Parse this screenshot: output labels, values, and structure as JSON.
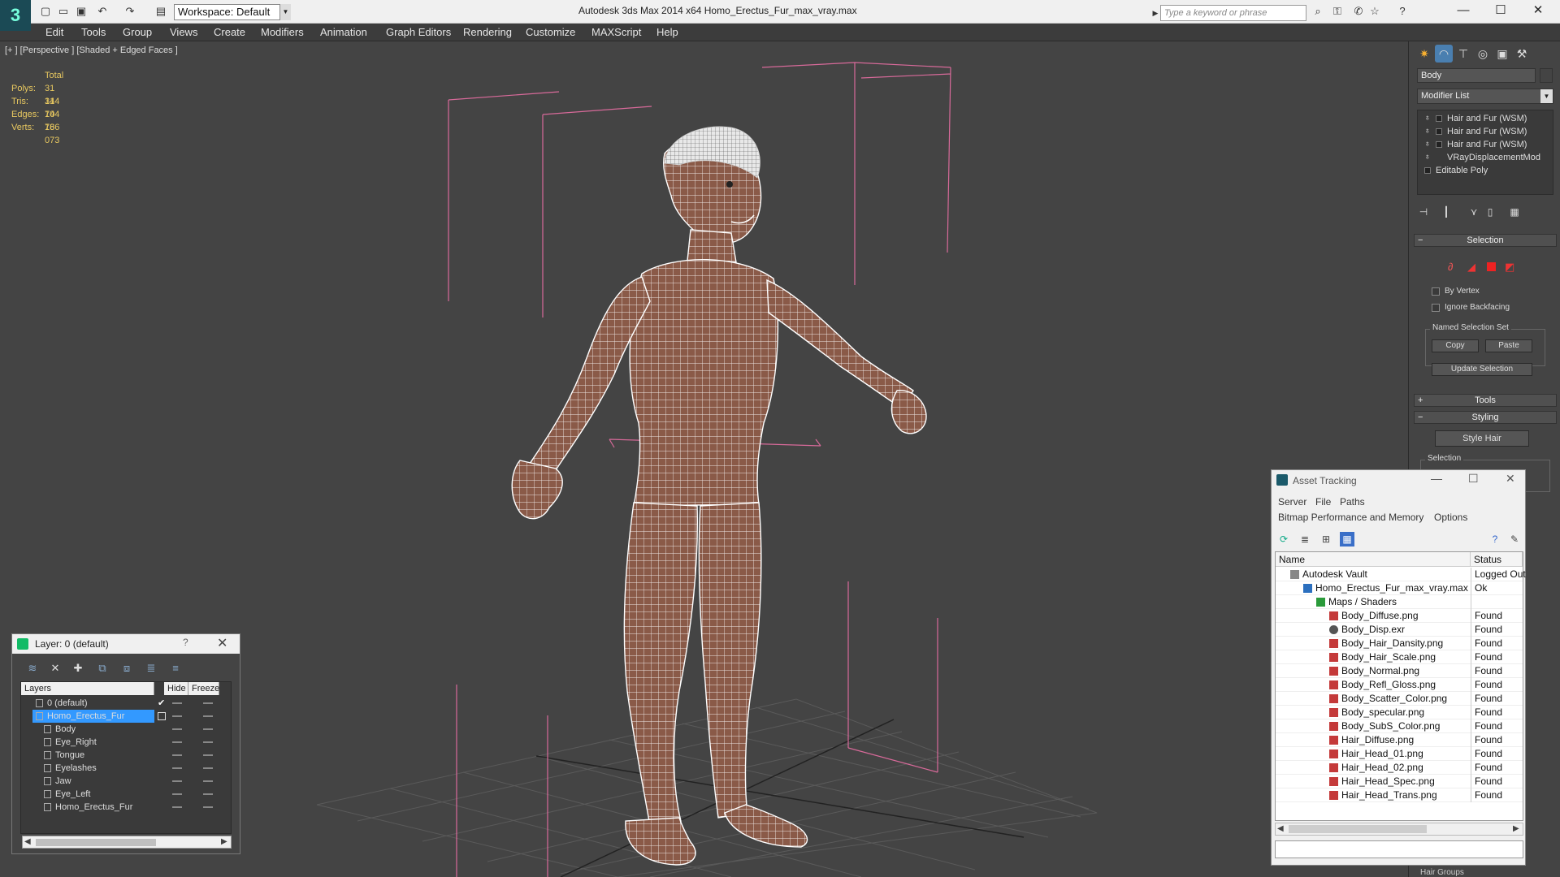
{
  "app": {
    "title": "Autodesk 3ds Max  2014 x64      Homo_Erectus_Fur_max_vray.max",
    "workspace": "Workspace: Default",
    "search_placeholder": "Type a keyword or phrase",
    "window_controls": {
      "minimize": "—",
      "maximize": "☐",
      "close": "✕"
    }
  },
  "menu": [
    "Edit",
    "Tools",
    "Group",
    "Views",
    "Create",
    "Modifiers",
    "Animation",
    "Graph Editors",
    "Rendering",
    "Customize",
    "MAXScript",
    "Help"
  ],
  "viewport": {
    "label": "[+ ] [Perspective ] [Shaded + Edged Faces ]",
    "stats": {
      "header": "Total",
      "rows": [
        {
          "label": "Polys:",
          "value": "31 144"
        },
        {
          "label": "Tris:",
          "value": "31 144"
        },
        {
          "label": "Edges:",
          "value": "70 786"
        },
        {
          "label": "Verts:",
          "value": "16 073"
        }
      ]
    }
  },
  "command_panel": {
    "object_name": "Body",
    "modifier_list": "Modifier List",
    "stack": [
      "Hair and Fur (WSM)",
      "Hair and Fur (WSM)",
      "Hair and Fur (WSM)",
      "VRayDisplacementMod",
      "Editable Poly"
    ],
    "selection": {
      "title": "Selection",
      "by_vertex": "By Vertex",
      "ignore_backfacing": "Ignore Backfacing",
      "named_set": "Named Selection Set",
      "copy": "Copy",
      "paste": "Paste",
      "update": "Update Selection"
    },
    "tools_rollout": "Tools",
    "styling_rollout": "Styling",
    "style_hair": "Style Hair",
    "styling_selection": "Selection",
    "bottom_rollout": "Hair Groups"
  },
  "layer_dialog": {
    "title": "Layer: 0 (default)",
    "help": "?",
    "close": "✕",
    "columns": {
      "layers": "Layers",
      "hide": "Hide",
      "freeze": "Freeze"
    },
    "rows": [
      {
        "name": "0 (default)",
        "level": 0,
        "checked": true,
        "selected": false
      },
      {
        "name": "Homo_Erectus_Fur",
        "level": 0,
        "checked": false,
        "selected": true
      },
      {
        "name": "Body",
        "level": 1,
        "checked": false,
        "selected": false
      },
      {
        "name": "Eye_Right",
        "level": 1,
        "checked": false,
        "selected": false
      },
      {
        "name": "Tongue",
        "level": 1,
        "checked": false,
        "selected": false
      },
      {
        "name": "Eyelashes",
        "level": 1,
        "checked": false,
        "selected": false
      },
      {
        "name": "Jaw",
        "level": 1,
        "checked": false,
        "selected": false
      },
      {
        "name": "Eye_Left",
        "level": 1,
        "checked": false,
        "selected": false
      },
      {
        "name": "Homo_Erectus_Fur",
        "level": 1,
        "checked": false,
        "selected": false
      }
    ]
  },
  "asset_tracking": {
    "title": "Asset Tracking",
    "menus": [
      "Server",
      "File",
      "Paths"
    ],
    "menus2": [
      "Bitmap Performance and Memory",
      "Options"
    ],
    "columns": {
      "name": "Name",
      "status": "Status"
    },
    "rows": [
      {
        "name": "Autodesk Vault",
        "status": "Logged Out",
        "level": 0,
        "icon": "vault"
      },
      {
        "name": "Homo_Erectus_Fur_max_vray.max",
        "status": "Ok",
        "level": 1,
        "icon": "max"
      },
      {
        "name": "Maps / Shaders",
        "status": "",
        "level": 2,
        "icon": "maps"
      },
      {
        "name": "Body_Diffuse.png",
        "status": "Found",
        "level": 3,
        "icon": "png"
      },
      {
        "name": "Body_Disp.exr",
        "status": "Found",
        "level": 3,
        "icon": "exr"
      },
      {
        "name": "Body_Hair_Dansity.png",
        "status": "Found",
        "level": 3,
        "icon": "png"
      },
      {
        "name": "Body_Hair_Scale.png",
        "status": "Found",
        "level": 3,
        "icon": "png"
      },
      {
        "name": "Body_Normal.png",
        "status": "Found",
        "level": 3,
        "icon": "png"
      },
      {
        "name": "Body_Refl_Gloss.png",
        "status": "Found",
        "level": 3,
        "icon": "png"
      },
      {
        "name": "Body_Scatter_Color.png",
        "status": "Found",
        "level": 3,
        "icon": "png"
      },
      {
        "name": "Body_specular.png",
        "status": "Found",
        "level": 3,
        "icon": "png"
      },
      {
        "name": "Body_SubS_Color.png",
        "status": "Found",
        "level": 3,
        "icon": "png"
      },
      {
        "name": "Hair_Diffuse.png",
        "status": "Found",
        "level": 3,
        "icon": "png"
      },
      {
        "name": "Hair_Head_01.png",
        "status": "Found",
        "level": 3,
        "icon": "png"
      },
      {
        "name": "Hair_Head_02.png",
        "status": "Found",
        "level": 3,
        "icon": "png"
      },
      {
        "name": "Hair_Head_Spec.png",
        "status": "Found",
        "level": 3,
        "icon": "png"
      },
      {
        "name": "Hair_Head_Trans.png",
        "status": "Found",
        "level": 3,
        "icon": "png"
      }
    ]
  },
  "colors": {
    "stats_text": "#e8c860",
    "selection_blue": "#3399ff",
    "bounding_box": "#d86a9a",
    "skin": "#8a5a48",
    "wire": "#ffffff"
  }
}
